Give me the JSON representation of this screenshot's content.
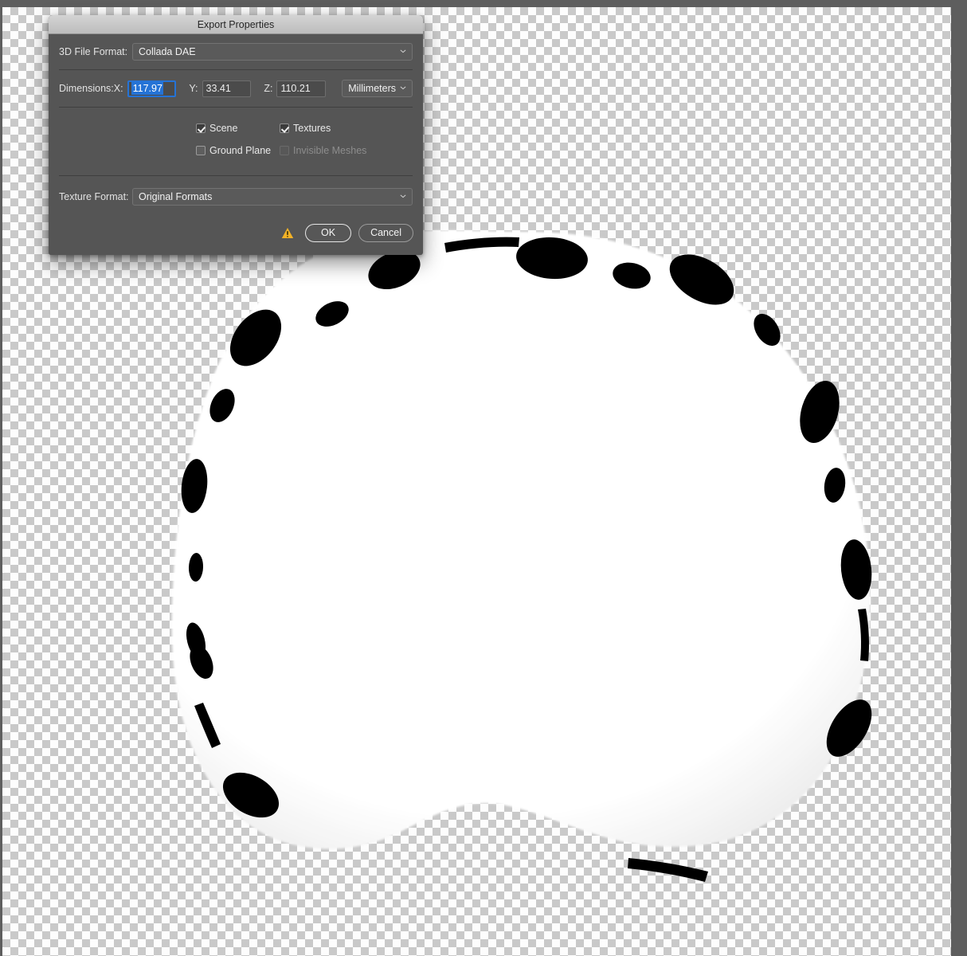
{
  "canvas": {
    "background_color": "#5e5e5e",
    "checker_light": "#fdfdfd",
    "checker_dark": "#c9c9c9",
    "artwork_description": "white-blob-uv-layout-with-black-marks"
  },
  "dialog": {
    "title": "Export Properties",
    "file_format": {
      "label": "3D File Format:",
      "value": "Collada DAE",
      "chevron": "chevron-down-icon"
    },
    "dimensions": {
      "label": "Dimensions:",
      "axes": [
        {
          "label": "X:",
          "value": "117.97",
          "focused": true,
          "selected": true
        },
        {
          "label": "Y:",
          "value": "33.41",
          "focused": false,
          "selected": false
        },
        {
          "label": "Z:",
          "value": "110.21",
          "focused": false,
          "selected": false
        }
      ],
      "units": {
        "value": "Millimeters",
        "chevron": "chevron-down-icon"
      }
    },
    "options": [
      {
        "label": "Scene",
        "checked": true,
        "disabled": false
      },
      {
        "label": "Textures",
        "checked": true,
        "disabled": false
      },
      {
        "label": "Ground Plane",
        "checked": false,
        "disabled": false
      },
      {
        "label": "Invisible Meshes",
        "checked": false,
        "disabled": true
      }
    ],
    "texture_format": {
      "label": "Texture Format:",
      "value": "Original Formats",
      "chevron": "chevron-down-icon"
    },
    "footer": {
      "warning_icon": "warning-triangle-icon",
      "warning_color": "#f2b227",
      "ok_label": "OK",
      "cancel_label": "Cancel"
    },
    "accent_color": "#2573d6",
    "background_color": "#555555",
    "titlebar_color": "#c6c6c6"
  }
}
